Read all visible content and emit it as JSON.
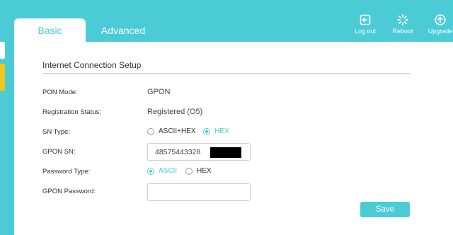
{
  "tabs": [
    {
      "label": "Basic",
      "active": true
    },
    {
      "label": "Advanced",
      "active": false
    }
  ],
  "actions": {
    "logout": {
      "label": "Log out",
      "icon": "logout-icon"
    },
    "reboot": {
      "label": "Reboot",
      "icon": "reboot-icon"
    },
    "upgrade": {
      "label": "Upgrade",
      "icon": "upgrade-icon"
    }
  },
  "section": {
    "title": "Internet Connection Setup"
  },
  "form": {
    "pon_mode": {
      "label": "PON Mode:",
      "value": "GPON"
    },
    "registration_status": {
      "label": "Registration Status:",
      "value": "Registered (O5)"
    },
    "sn_type": {
      "label": "SN Type:",
      "options": [
        {
          "label": "ASCII+HEX",
          "checked": false
        },
        {
          "label": "HEX",
          "checked": true
        }
      ]
    },
    "gpon_sn": {
      "label": "GPON SN:",
      "value": "48575443328"
    },
    "password_type": {
      "label": "Password Type:",
      "options": [
        {
          "label": "ASCII",
          "checked": true
        },
        {
          "label": "HEX",
          "checked": false
        }
      ]
    },
    "gpon_password": {
      "label": "GPON Password:",
      "value": ""
    }
  },
  "save_label": "Save",
  "colors": {
    "accent": "#4acbd6",
    "background": "#4acbd6",
    "panel": "#ffffff",
    "left_marker": "#f5c518"
  }
}
